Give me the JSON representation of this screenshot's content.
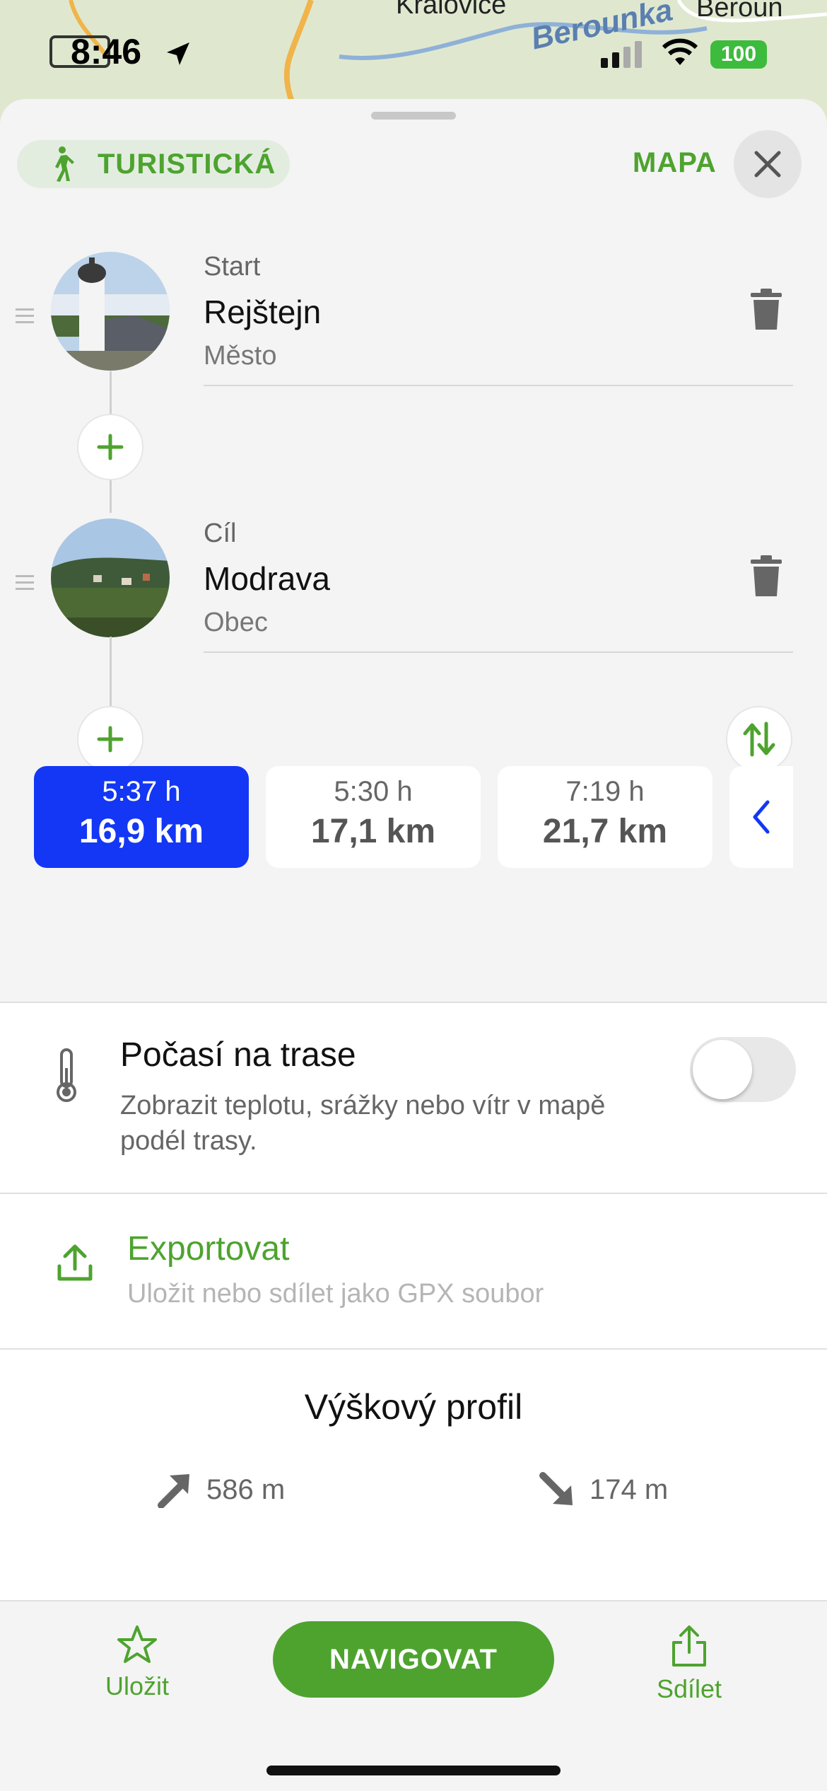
{
  "status_bar": {
    "time": "8:46",
    "battery": "100"
  },
  "map": {
    "labels": [
      "Kralovice",
      "Berounka",
      "Beroun"
    ]
  },
  "header": {
    "mode_label": "TURISTICKÁ",
    "map_link": "MAPA"
  },
  "waypoints": [
    {
      "kind": "Start",
      "name": "Rejštejn",
      "subtitle": "Město"
    },
    {
      "kind": "Cíl",
      "name": "Modrava",
      "subtitle": "Obec"
    }
  ],
  "routes": [
    {
      "duration": "5:37 h",
      "distance": "16,9 km",
      "selected": true
    },
    {
      "duration": "5:30 h",
      "distance": "17,1 km",
      "selected": false
    },
    {
      "duration": "7:19 h",
      "distance": "21,7 km",
      "selected": false
    }
  ],
  "weather": {
    "title": "Počasí na trase",
    "description": "Zobrazit teplotu, srážky nebo vítr v mapě podél trasy.",
    "toggle_on": false
  },
  "export": {
    "title": "Exportovat",
    "subtitle": "Uložit nebo sdílet jako GPX soubor"
  },
  "elevation": {
    "title": "Výškový profil",
    "ascent": "586 m",
    "descent": "174 m"
  },
  "bottom_bar": {
    "save_label": "Uložit",
    "navigate_label": "NAVIGOVAT",
    "share_label": "Sdílet"
  },
  "colors": {
    "accent": "#4ea32f",
    "selected_route": "#1337f5"
  }
}
